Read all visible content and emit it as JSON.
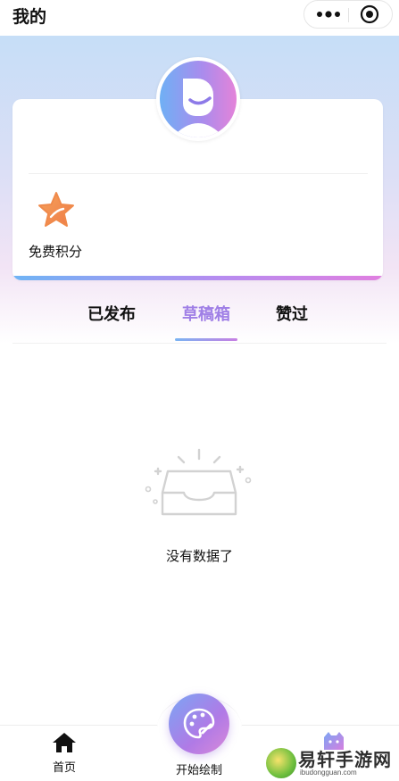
{
  "header": {
    "title": "我的",
    "more_icon": "more-dots-icon",
    "target_icon": "target-icon"
  },
  "profile": {
    "avatar_icon": "smiley-avatar-icon",
    "points_icon": "star-icon",
    "points_label": "免费积分"
  },
  "tabs": [
    {
      "label": "已发布",
      "active": false
    },
    {
      "label": "草稿箱",
      "active": true
    },
    {
      "label": "赞过",
      "active": false
    }
  ],
  "empty_state": {
    "icon": "empty-box-icon",
    "text": "没有数据了"
  },
  "tab_bar": {
    "home_label": "首页",
    "draw_label": "开始绘制",
    "mine_icon": "cat-face-icon"
  },
  "watermark": {
    "text": "易轩手游网",
    "subtext": "ibudongguan.com"
  },
  "colors": {
    "accent_purple": "#9f7fe6",
    "accent_blue": "#6fb4f5",
    "accent_pink": "#e07fe0",
    "star_orange": "#f08a4b"
  }
}
